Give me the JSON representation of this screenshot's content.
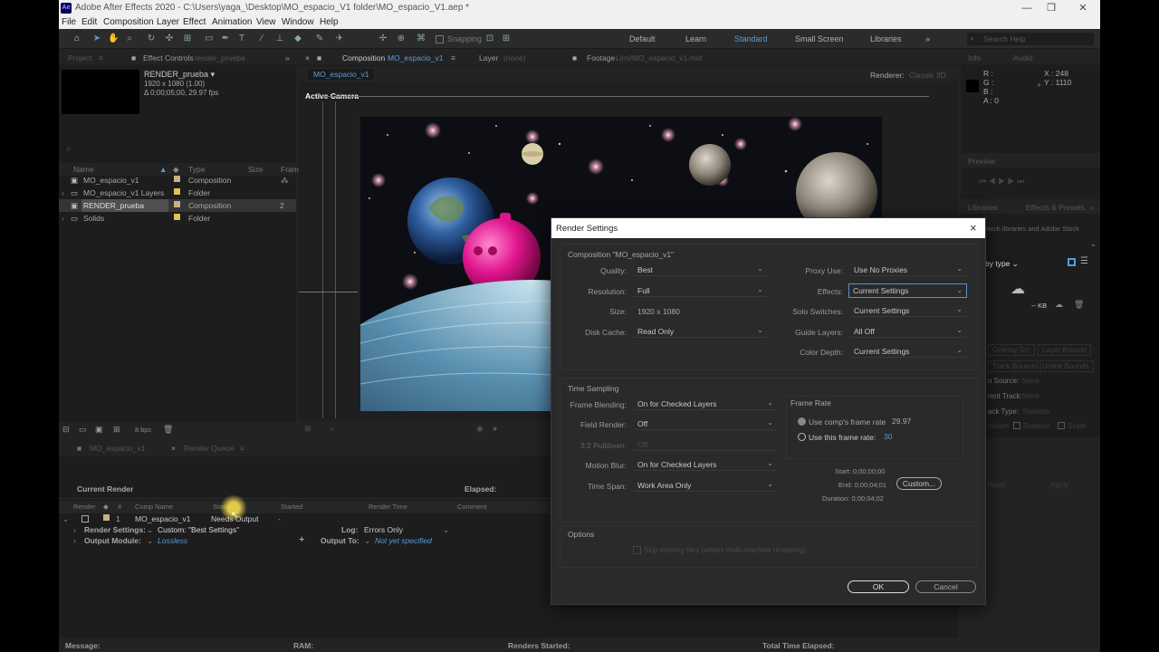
{
  "window": {
    "title": "Adobe After Effects 2020 - C:\\Users\\yaga_\\Desktop\\MO_espacio_V1 folder\\MO_espacio_V1.aep *",
    "app_icon": "Ae",
    "controls": [
      "—",
      "❐",
      "✕"
    ]
  },
  "menu": [
    "File",
    "Edit",
    "Composition",
    "Layer",
    "Effect",
    "Animation",
    "View",
    "Window",
    "Help"
  ],
  "toolbar": {
    "snapping": "Snapping",
    "workspaces": [
      "Default",
      "Learn",
      "Standard",
      "Small Screen",
      "Libraries"
    ],
    "active_workspace": "Standard",
    "search_placeholder": "Search Help"
  },
  "project_panel": {
    "tab_project": "Project",
    "tab_effect_controls": "Effect Controls",
    "tab_effect_target": "render_prueba",
    "selected_name": "RENDER_prueba",
    "selected_dims": "1920 x 1080 (1.00)",
    "selected_duration": "Δ 0;00;05;00, 29.97 fps",
    "columns": [
      "Name",
      "Type",
      "Size",
      "Fram"
    ],
    "items": [
      {
        "name": "MO_espacio_v1",
        "type": "Composition",
        "size": "",
        "color": "#c8b088",
        "icon": "composition-icon",
        "expand": ""
      },
      {
        "name": "MO_espacio_v1 Layers",
        "type": "Folder",
        "size": "",
        "color": "#e0c050",
        "icon": "folder-icon",
        "expand": "›"
      },
      {
        "name": "RENDER_prueba",
        "type": "Composition",
        "size": "2",
        "color": "#c8b088",
        "icon": "composition-icon",
        "expand": ""
      },
      {
        "name": "Solids",
        "type": "Folder",
        "size": "",
        "color": "#e0c050",
        "icon": "folder-icon",
        "expand": "›"
      }
    ],
    "bpc": "8 bpc"
  },
  "comp_panel": {
    "tab_composition": "Composition",
    "tab_comp_name": "MO_espacio_v1",
    "tab_layer": "Layer",
    "tab_layer_value": "(none)",
    "tab_footage": "Footage",
    "tab_footage_value": "Limi/MO_espacio_v1.mxf",
    "subtab": "MO_espacio_v1",
    "renderer_label": "Renderer:",
    "renderer_value": "Classic 3D",
    "active_camera": "Active Camera"
  },
  "right_panel": {
    "tab_info": "Info",
    "tab_audio": "Audio",
    "info_r": "R :",
    "info_g": "G :",
    "info_b": "B :",
    "info_a": "A : 0",
    "info_x": "X : 248",
    "info_y": "Y : 1110",
    "preview": "Preview",
    "libraries": "Libraries",
    "effects_presets": "Effects & Presets",
    "library_hint": "Search libraries and Adobe Stock",
    "by_type": "by type",
    "kb_label": "-- KB",
    "blend_a": "Overlay Src",
    "blend_b": "Layer Bounds",
    "blend_c": "Track Bounds",
    "blend_d": "Unlink Bounds",
    "track_source": "n Source:",
    "track_source_value": "None",
    "current_track": "rent Track:",
    "current_track_value": "None",
    "track_type": "ack Type:",
    "track_type_value": "Stabilize",
    "position_label": "osition",
    "rotation_label": "Rotation",
    "scale_label": "Scale",
    "reset": "Reset",
    "apply": "Apply"
  },
  "render_queue": {
    "tab_comp": "MO_espacio_v1",
    "tab_rq": "Render Queue",
    "current_render": "Current Render",
    "elapsed": "Elapsed:",
    "columns": [
      "Render",
      "#",
      "Comp Name",
      "Status",
      "Started",
      "Render Time",
      "Comment"
    ],
    "item_num": "1",
    "item_comp": "MO_espacio_v1",
    "item_status": "Needs Output",
    "item_started": "-",
    "render_settings_label": "Render Settings:",
    "render_settings_value": "Custom: \"Best Settings\"",
    "log_label": "Log:",
    "log_value": "Errors Only",
    "output_module_label": "Output Module:",
    "output_module_value": "Lossless",
    "output_to_label": "Output To:",
    "output_to_value": "Not yet specified"
  },
  "status_bar": {
    "message": "Message:",
    "ram": "RAM:",
    "renders_started": "Renders Started:",
    "total_time": "Total Time Elapsed:"
  },
  "dialog": {
    "title": "Render Settings",
    "composition": "Composition \"MO_espacio_v1\"",
    "quality_label": "Quality:",
    "quality": "Best",
    "resolution_label": "Resolution:",
    "resolution": "Full",
    "size_label": "Size:",
    "size": "1920 x 1080",
    "disk_cache_label": "Disk Cache:",
    "disk_cache": "Read Only",
    "proxy_use_label": "Proxy Use:",
    "proxy_use": "Use No Proxies",
    "effects_label": "Effects:",
    "effects": "Current Settings",
    "solo_switches_label": "Solo Switches:",
    "solo_switches": "Current Settings",
    "guide_layers_label": "Guide Layers:",
    "guide_layers": "All Off",
    "color_depth_label": "Color Depth:",
    "color_depth": "Current Settings",
    "time_sampling": "Time Sampling",
    "frame_blending_label": "Frame Blending:",
    "frame_blending": "On for Checked Layers",
    "field_render_label": "Field Render:",
    "field_render": "Off",
    "pulldown_label": "3:2 Pulldown:",
    "pulldown": "Off",
    "motion_blur_label": "Motion Blur:",
    "motion_blur": "On for Checked Layers",
    "time_span_label": "Time Span:",
    "time_span": "Work Area Only",
    "frame_rate": "Frame Rate",
    "use_comp_rate": "Use comp's frame rate",
    "comp_rate_value": "29.97",
    "use_this_rate": "Use this frame rate:",
    "this_rate_value": "30",
    "start": "Start: 0;00;00;00",
    "end": "End: 0;00;04;01",
    "duration": "Duration: 0;00;04;02",
    "custom_button": "Custom...",
    "options": "Options",
    "skip_existing": "Skip existing files (allows multi-machine rendering)",
    "ok": "OK",
    "cancel": "Cancel"
  }
}
